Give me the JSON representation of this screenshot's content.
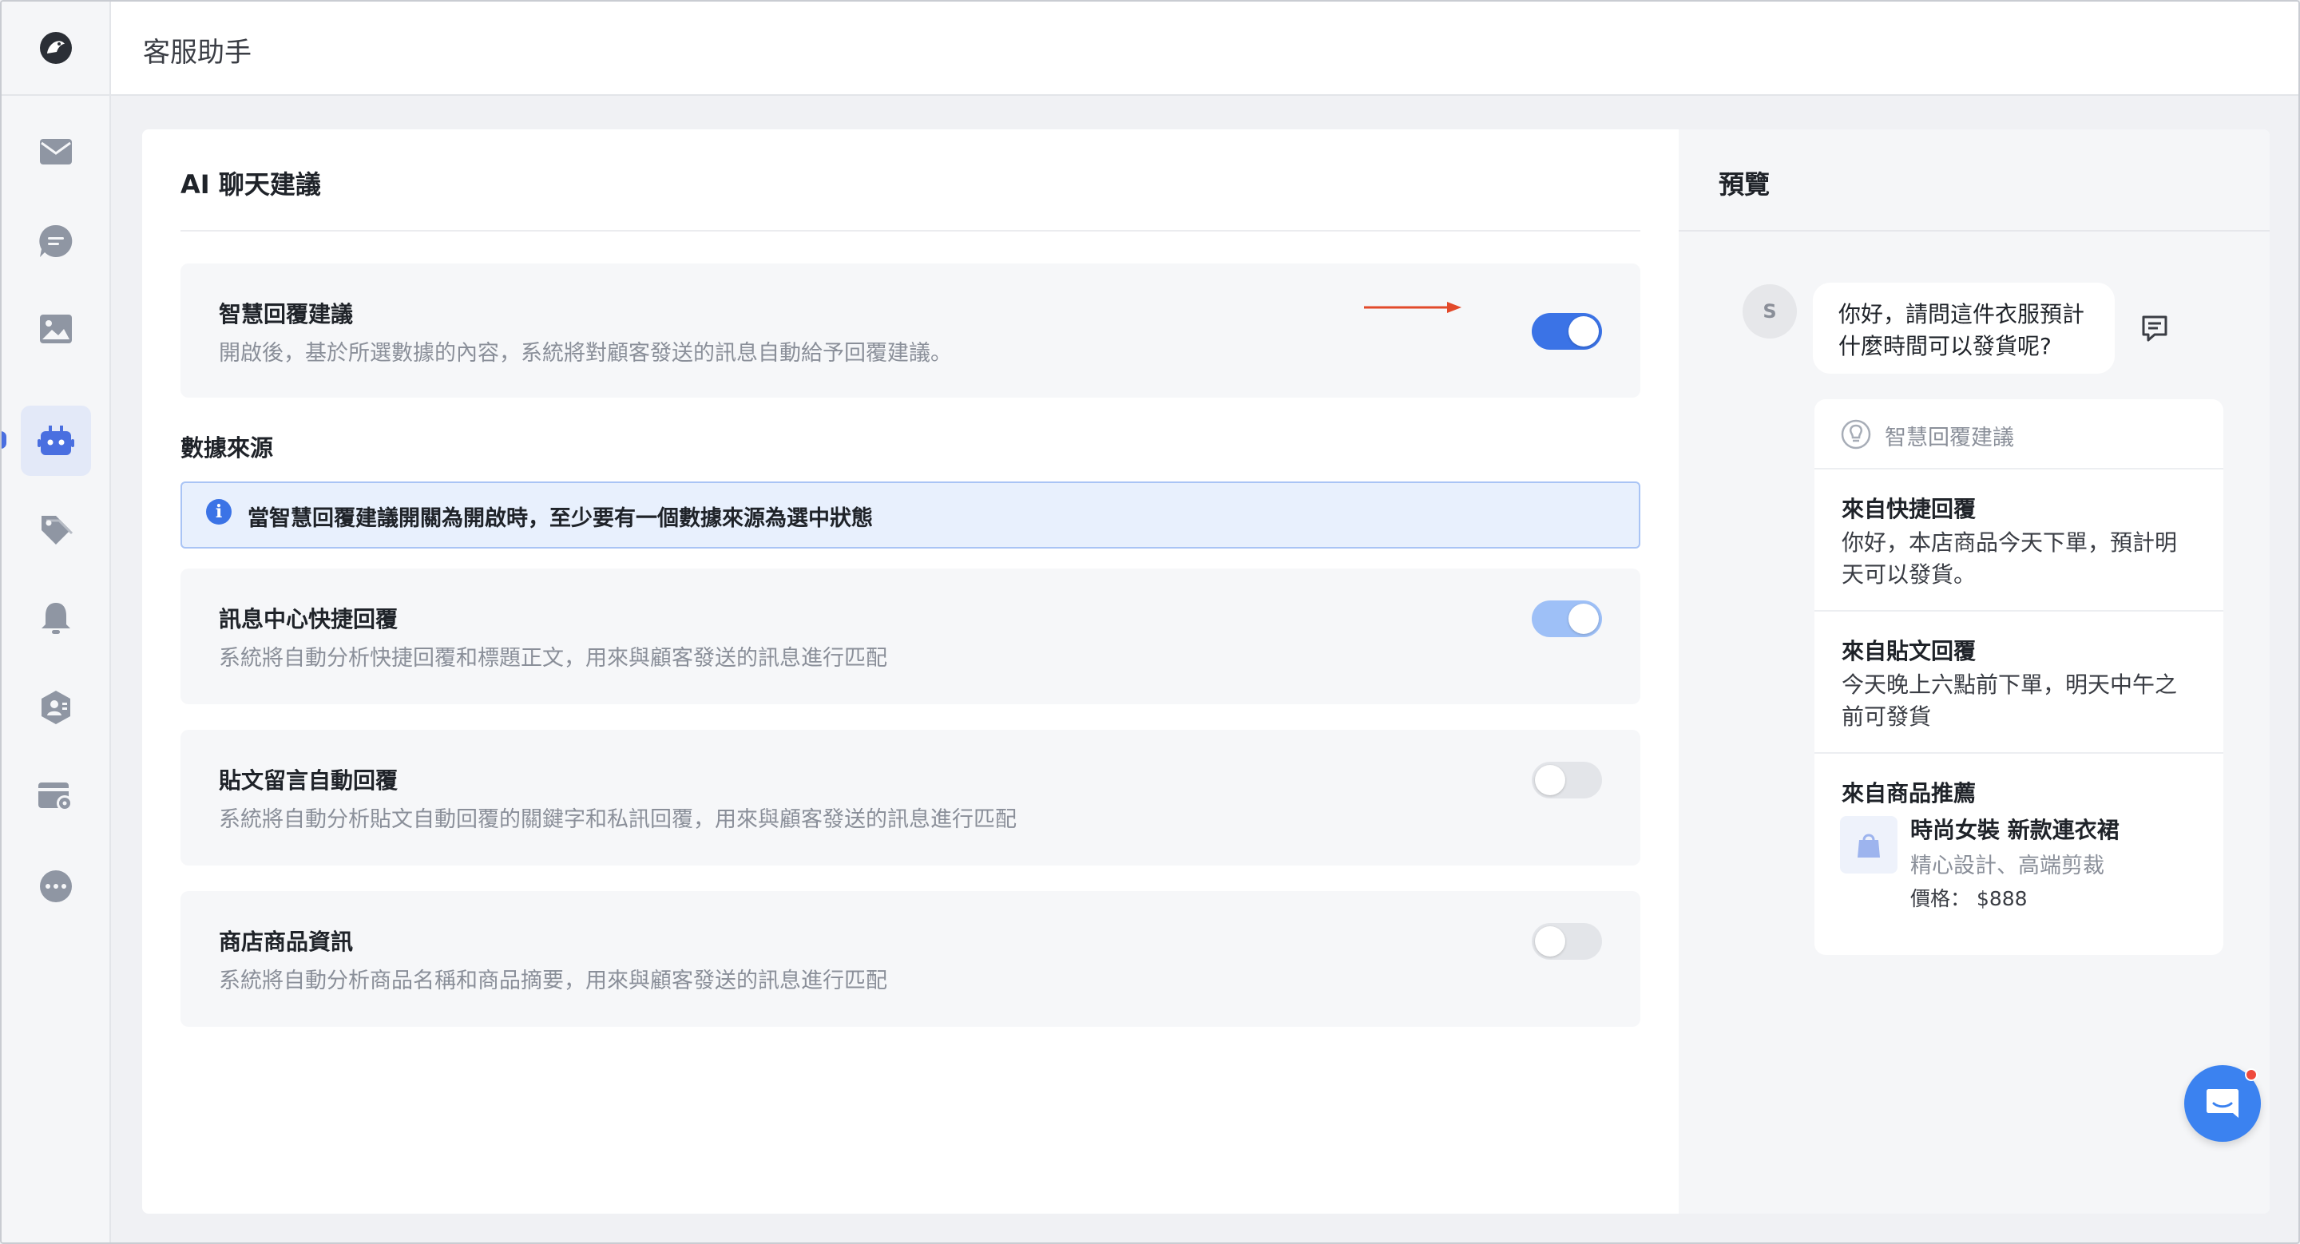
{
  "header": {
    "title": "客服助手"
  },
  "sidebar": {
    "items": [
      {
        "name": "inbox"
      },
      {
        "name": "chat"
      },
      {
        "name": "media"
      },
      {
        "name": "bot"
      },
      {
        "name": "tags"
      },
      {
        "name": "notifications"
      },
      {
        "name": "contacts"
      },
      {
        "name": "settings"
      },
      {
        "name": "more"
      }
    ],
    "active": "bot"
  },
  "main": {
    "section_title": "AI 聊天建議",
    "smart_reply": {
      "title": "智慧回覆建議",
      "desc": "開啟後，基於所選數據的內容，系統將對顧客發送的訊息自動給予回覆建議。",
      "enabled": true
    },
    "data_source_title": "數據來源",
    "info_text": "當智慧回覆建議開關為開啟時，至少要有一個數據來源為選中狀態",
    "sources": [
      {
        "title": "訊息中心快捷回覆",
        "desc": "系統將自動分析快捷回覆和標題正文，用來與顧客發送的訊息進行匹配",
        "state": "on-disabled"
      },
      {
        "title": "貼文留言自動回覆",
        "desc": "系統將自動分析貼文自動回覆的關鍵字和私訊回覆，用來與顧客發送的訊息進行匹配",
        "state": "off"
      },
      {
        "title": "商店商品資訊",
        "desc": "系統將自動分析商品名稱和商品摘要，用來與顧客發送的訊息進行匹配",
        "state": "off"
      }
    ]
  },
  "preview": {
    "title": "預覽",
    "avatar_letter": "S",
    "customer_message_line1": "你好，請問這件衣服預計",
    "customer_message_line2": "什麼時間可以發貨呢?",
    "suggest_header": "智慧回覆建議",
    "quick_reply": {
      "title": "來自快捷回覆",
      "line1": "你好，本店商品今天下單，預計明",
      "line2": "天可以發貨。"
    },
    "post_reply": {
      "title": "來自貼文回覆",
      "line1": "今天晚上六點前下單，明天中午之",
      "line2": "前可發貨"
    },
    "product_rec": {
      "title": "來自商品推薦",
      "name": "時尚女裝 新款連衣裙",
      "desc": "精心設計、高端剪裁",
      "price": "價格：  $888"
    }
  },
  "colors": {
    "accent": "#3b73e6",
    "arrow": "#e24a2b",
    "fab": "#3b82f0"
  }
}
